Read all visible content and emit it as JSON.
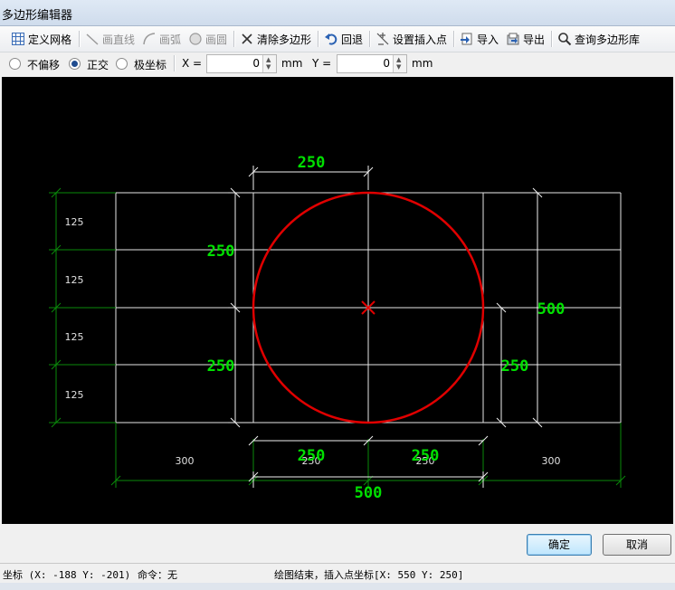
{
  "window": {
    "title": "多边形编辑器"
  },
  "toolbar": {
    "define_grid": "定义网格",
    "draw_line": "画直线",
    "draw_arc": "画弧",
    "draw_circle": "画圆",
    "clear_polygon": "清除多边形",
    "undo": "回退",
    "set_insert_point": "设置插入点",
    "import": "导入",
    "export": "导出",
    "query_library": "查询多边形库"
  },
  "options": {
    "no_offset": "不偏移",
    "orthogonal": "正交",
    "polar": "极坐标",
    "selected": "正交",
    "x_label": "X =",
    "x_value": "0",
    "x_unit": "mm",
    "y_label": "Y =",
    "y_value": "0",
    "y_unit": "mm"
  },
  "drawing": {
    "row_labels": [
      "125",
      "125",
      "125",
      "125"
    ],
    "col_labels": [
      "300",
      "250",
      "250",
      "300"
    ],
    "dim_top": "250",
    "dim_left_upper": "250",
    "dim_left_lower": "250",
    "dim_right": "500",
    "dim_right_lower": "250",
    "dim_bottom_left": "250",
    "dim_bottom_right": "250",
    "dim_bottom_total": "500",
    "colors": {
      "circle": "#e00000",
      "dimension_text": "#00e000",
      "grid": "#e6e6e6",
      "axis_dims": "#007a00"
    }
  },
  "buttons": {
    "ok": "确定",
    "cancel": "取消"
  },
  "status": {
    "coord": "坐标 (X: -188 Y: -201)",
    "command": "命令：无",
    "message": "绘图结束，插入点坐标[X: 550 Y: 250]"
  }
}
